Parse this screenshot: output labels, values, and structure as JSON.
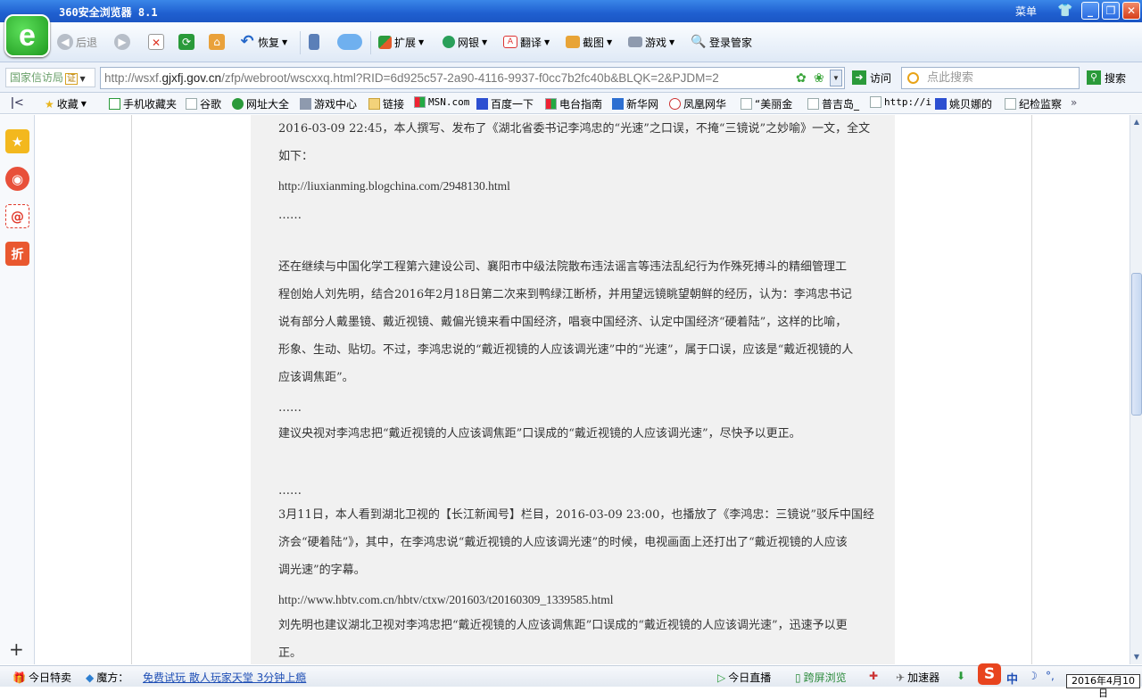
{
  "window": {
    "title": "360安全浏览器 8.1",
    "menu_label": "菜单",
    "minimize": "_",
    "maximize": "❐",
    "close": "✕"
  },
  "toolbar": {
    "back": "后退",
    "restore": "恢复",
    "extensions": "扩展",
    "netbank": "网银",
    "translate": "翻译",
    "screenshot": "截图",
    "games": "游戏",
    "login_manager": "登录管家"
  },
  "addressbar": {
    "site_badge": "国家信访局",
    "cert_badge": "证",
    "url_prefix": "http://wsxf.",
    "url_domain": "gjxfj.gov.cn",
    "url_path": "/zfp/webroot/wscxxq.html?RID=6d925c57-2a90-4116-9937-f0cc7b2fc40b&BLQK=2&PJDM=2",
    "go_label": "访问",
    "search_placeholder": "点此搜索",
    "search_button": "搜索"
  },
  "favorites": {
    "items": [
      "收藏",
      "手机收藏夹",
      "谷歌",
      "网址大全",
      "游戏中心",
      "链接",
      "MSN.com",
      "百度一下",
      "电台指南",
      "新华网",
      "凤凰网华",
      "“美丽金",
      "普吉岛_",
      "http://i",
      "姚贝娜的",
      "纪检监察"
    ]
  },
  "article": {
    "lines": [
      "2016-03-09 22:45，本人撰写、发布了《湖北省委书记李鸿忠的“光速”之口误，不掩“三镜说”之妙喻》一文，全文",
      "如下：",
      "http://liuxianming.blogchina.com/2948130.html",
      "……",
      "还在继续与中国化学工程第六建设公司、襄阳市中级法院散布违法谣言等违法乱纪行为作殊死搏斗的精细管理工",
      "程创始人刘先明，结合2016年2月18日第二次来到鸭绿江断桥，并用望远镜眺望朝鲜的经历，认为：李鸿忠书记",
      "说有部分人戴墨镜、戴近视镜、戴偏光镜来看中国经济，唱衰中国经济、认定中国经济“硬着陆”，这样的比喻，",
      "形象、生动、贴切。不过，李鸿忠说的“戴近视镜的人应该调光速”中的“光速”，属于口误，应该是“戴近视镜的人",
      "应该调焦距”。",
      "……",
      "建议央视对李鸿忠把“戴近视镜的人应该调焦距”口误成的“戴近视镜的人应该调光速”，尽快予以更正。",
      "……",
      "3月11日，本人看到湖北卫视的【长江新闻号】栏目，2016-03-09 23:00，也播放了《李鸿忠：三镜说”驳斥中国经",
      "济会“硬着陆”》，其中，在李鸿忠说“戴近视镜的人应该调光速”的时候，电视画面上还打出了“戴近视镜的人应该",
      "调光速”的字幕。",
      "http://www.hbtv.com.cn/hbtv/ctxw/201603/t20160309_1339585.html",
      "刘先明也建议湖北卫视对李鸿忠把“戴近视镜的人应该调焦距”口误成的“戴近视镜的人应该调光速”，迅速予以更",
      "正。"
    ]
  },
  "statusbar": {
    "today_sale": "今日特卖",
    "magic": "魔方：",
    "promo": "免费试玩  散人玩家天堂  3分钟上瘾",
    "live": "今日直播",
    "cross_screen": "跨屏浏览",
    "accelerator": "加速器",
    "ime_chinese": "中",
    "clock": "2016年4月10日"
  }
}
